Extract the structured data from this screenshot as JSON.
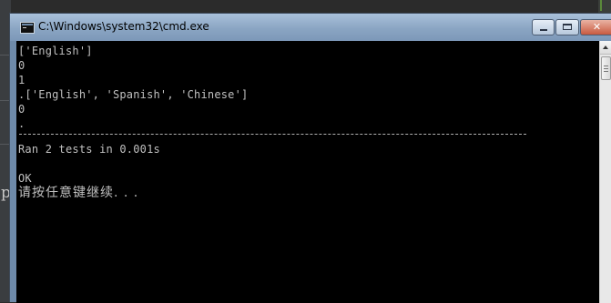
{
  "window": {
    "title": "C:\\Windows\\system32\\cmd.exe",
    "icon": "cmd-icon",
    "controls": {
      "minimize": "minimize-icon",
      "maximize": "maximize-icon",
      "close": "close-icon",
      "close_glyph": "✕"
    }
  },
  "console": {
    "lines": [
      "['English']",
      "0",
      "1",
      ".['English', 'Spanish', 'Chinese']",
      "0",
      ".",
      "Ran 2 tests in 0.001s",
      "",
      "OK",
      "请按任意键继续. . ."
    ]
  },
  "background": {
    "partial_text": "p"
  },
  "colors": {
    "console_bg": "#000000",
    "console_text": "#c0c0c0",
    "titlebar": "#8aa5c3",
    "close_button": "#c85a40"
  }
}
